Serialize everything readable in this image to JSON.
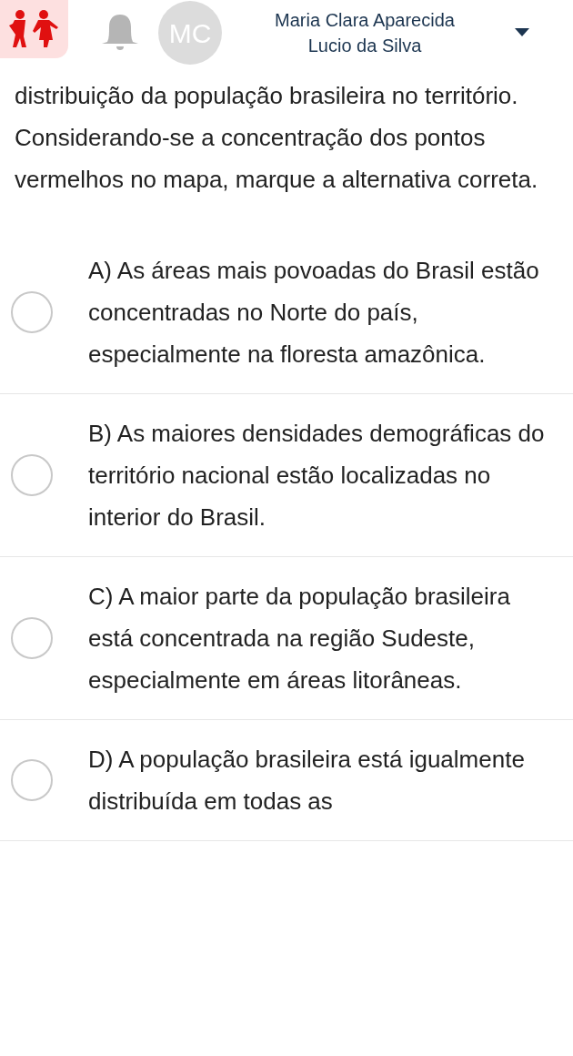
{
  "header": {
    "user_name_lines": [
      "Maria Clara Aparecida",
      "Lucio da Silva"
    ],
    "avatar_initials": "MC"
  },
  "question": {
    "text": "distribuição da população brasileira no território. Considerando-se a concentração dos pontos vermelhos no mapa, marque a alternativa correta."
  },
  "options": [
    {
      "text": "A) As áreas mais povoadas do Brasil estão concentradas no Norte do país, especialmente na floresta amazônica.",
      "selected": false
    },
    {
      "text": "B) As maiores densidades demográficas do território nacional estão localizadas no interior do Brasil.",
      "selected": false
    },
    {
      "text": "C) A maior parte da população brasileira está concentrada na região Sudeste, especialmente em áreas litorâneas.",
      "selected": false
    },
    {
      "text": "D) A população brasileira está igualmente distribuída em todas as",
      "selected": false
    }
  ]
}
